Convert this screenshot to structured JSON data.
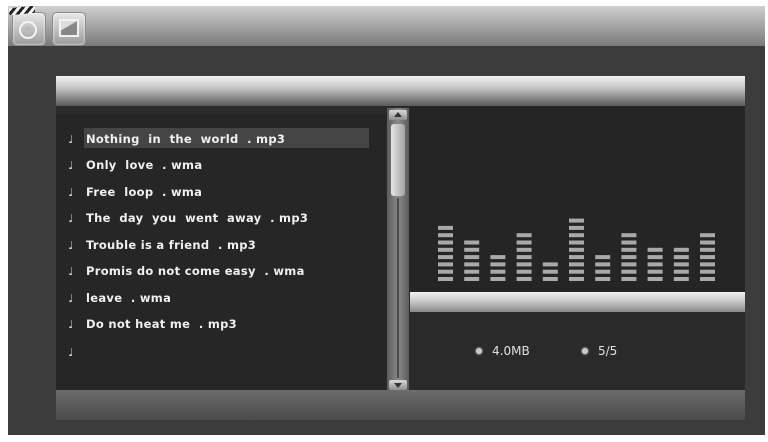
{
  "topbar": {
    "icons": [
      "music-icon",
      "photo-icon"
    ]
  },
  "playlist": {
    "tracks": [
      {
        "name": "Nothing  in  the  world  . mp3",
        "selected": true
      },
      {
        "name": "Only  love  . wma",
        "selected": false
      },
      {
        "name": "Free  loop  . wma",
        "selected": false
      },
      {
        "name": "The  day  you  went  away  . mp3",
        "selected": false
      },
      {
        "name": "Trouble is a friend  . mp3",
        "selected": false
      },
      {
        "name": "Promis do not come easy  . wma",
        "selected": false
      },
      {
        "name": "leave  . wma",
        "selected": false
      },
      {
        "name": "Do not heat me  . mp3",
        "selected": false
      },
      {
        "name": "",
        "selected": false
      }
    ],
    "note_glyph": "♩"
  },
  "equalizer": {
    "bar_levels": [
      8,
      6,
      4,
      7,
      3,
      9,
      4,
      7,
      5,
      5,
      7
    ],
    "max_level": 10,
    "bar_color": "#a9a9a9"
  },
  "info": {
    "size": "4.0MB",
    "count": "5/5"
  }
}
